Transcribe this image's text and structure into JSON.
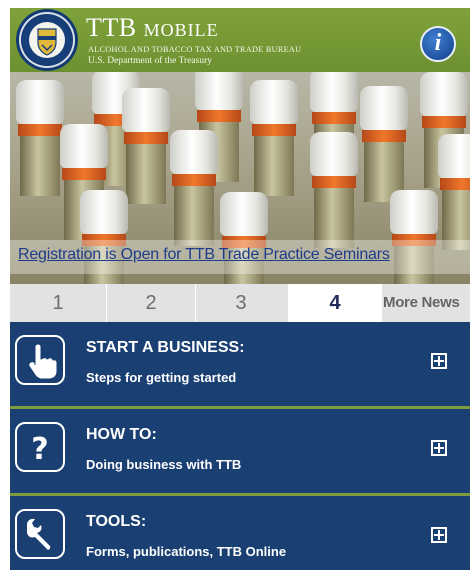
{
  "header": {
    "title": "TTB",
    "title_suffix": "MOBILE",
    "agency": "ALCOHOL AND TOBACCO TAX AND TRADE BUREAU",
    "department": "U.S. Department of the Treasury",
    "seal_icon": "treasury-seal-icon",
    "info_icon": "info-icon",
    "info_glyph": "i"
  },
  "banner": {
    "headline": "Registration is Open for TTB Trade Practice Seminars",
    "image_subject": "bottles-photo"
  },
  "pager": {
    "pages": [
      "1",
      "2",
      "3",
      "4"
    ],
    "active_page": "4",
    "more_label": "More News"
  },
  "menu": {
    "items": [
      {
        "label": "START A BUSINESS:",
        "description": "Steps for getting started",
        "icon": "pointing-hand-icon",
        "expand_icon": "expand-plus-icon"
      },
      {
        "label": "HOW TO:",
        "description": "Doing business with TTB",
        "icon": "question-mark-icon",
        "expand_icon": "expand-plus-icon"
      },
      {
        "label": "TOOLS:",
        "description": "Forms, publications, TTB Online",
        "icon": "wrench-icon",
        "expand_icon": "expand-plus-icon"
      }
    ]
  },
  "colors": {
    "header_green": "#7fa23b",
    "menu_blue": "#1a3f73",
    "divider_green": "#7d9c3f",
    "link_blue": "#1d3c8a",
    "active_page_text": "#222a5a"
  }
}
